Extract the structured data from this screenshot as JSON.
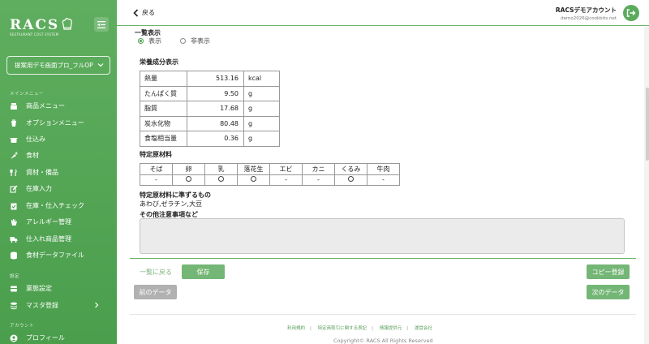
{
  "sidebar": {
    "logo": "RACS",
    "logo_sub": "RESTAURANT COST SYSTEM",
    "store_select": "提案用デモ画面プロ_フルOP",
    "section_main": "メインメニュー",
    "main_items": [
      {
        "label": "商品メニュー",
        "icon": "register-icon"
      },
      {
        "label": "オプションメニュー",
        "icon": "cup-icon"
      },
      {
        "label": "仕込み",
        "icon": "pot-icon"
      },
      {
        "label": "食材",
        "icon": "carrot-icon"
      },
      {
        "label": "資材・備品",
        "icon": "utensils-icon"
      },
      {
        "label": "在庫入力",
        "icon": "edit-icon"
      },
      {
        "label": "在庫・仕入チェック",
        "icon": "clipboard-check-icon"
      },
      {
        "label": "アレルギー管理",
        "icon": "hand-icon"
      },
      {
        "label": "仕入れ商品管理",
        "icon": "truck-icon"
      },
      {
        "label": "食材データファイル",
        "icon": "database-icon"
      }
    ],
    "section_settings": "設定",
    "settings_items": [
      {
        "label": "業態設定",
        "icon": "store-icon"
      },
      {
        "label": "マスタ登録",
        "icon": "stack-icon"
      }
    ],
    "section_account": "アカウント",
    "account_items": [
      {
        "label": "プロフィール",
        "icon": "user-icon"
      }
    ]
  },
  "header": {
    "back_label": "戻る",
    "account_name": "RACSデモアカウント",
    "account_email": "demo2026@cookbits.net"
  },
  "main": {
    "list_display_label": "一覧表示",
    "radio_show": "表示",
    "radio_hide": "非表示",
    "radio_selected": "表示",
    "nutrition_label": "栄養成分表示",
    "nutrition": [
      {
        "name": "熱量",
        "value": "513.16",
        "unit": "kcal"
      },
      {
        "name": "たんぱく質",
        "value": "9.50",
        "unit": "g"
      },
      {
        "name": "脂質",
        "value": "17.68",
        "unit": "g"
      },
      {
        "name": "炭水化物",
        "value": "80.48",
        "unit": "g"
      },
      {
        "name": "食塩相当量",
        "value": "0.36",
        "unit": "g"
      }
    ],
    "allergen_label": "特定原材料",
    "allergen_headers": [
      "そば",
      "卵",
      "乳",
      "落花生",
      "エビ",
      "カニ",
      "くるみ",
      "牛肉"
    ],
    "allergen_values": [
      "-",
      "○",
      "○",
      "○",
      "-",
      "-",
      "○",
      "-"
    ],
    "allergen_similar_label": "特定原材料に準ずるもの",
    "allergen_similar_value": "あわび,ゼラチン,大豆",
    "notes_label": "その他注意事項など",
    "back_to_list": "一覧に戻る",
    "save_button": "保存",
    "copy_button": "コピー登録",
    "prev_button": "前のデータ",
    "next_button": "次のデータ"
  },
  "footer": {
    "links": [
      "利用規約",
      "特定商取引に関する表記",
      "情報提供元",
      "運営会社"
    ],
    "copyright": "Copyright© RACS All Rights Reserved"
  }
}
